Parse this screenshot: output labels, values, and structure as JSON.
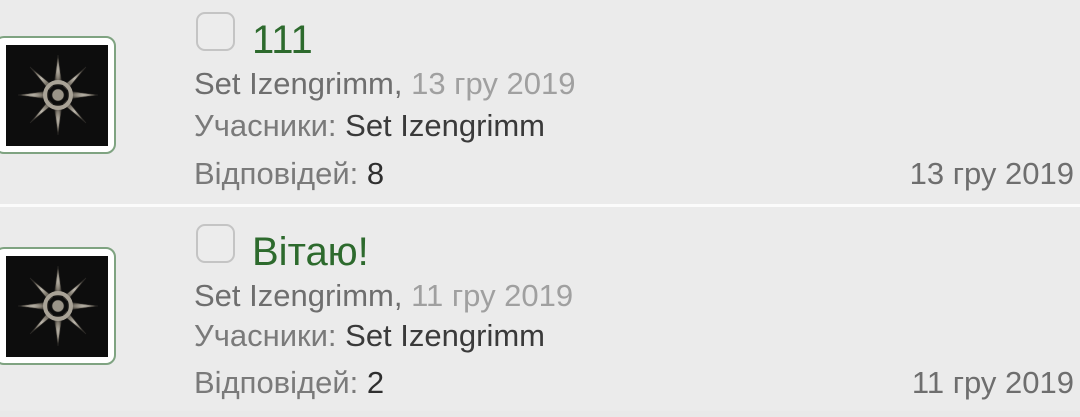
{
  "threads": [
    {
      "title": "111",
      "author": "Set Izengrimm",
      "start_date": "13 гру 2019",
      "participants_label": "Учасники:",
      "participants": "Set Izengrimm",
      "replies_label": "Відповідей:",
      "replies": "8",
      "last_post_date": "13 гру 2019",
      "avatar_icon": "chaos-star-icon"
    },
    {
      "title": "Вітаю!",
      "author": "Set Izengrimm",
      "start_date": "11 гру 2019",
      "participants_label": "Учасники:",
      "participants": "Set Izengrimm",
      "replies_label": "Відповідей:",
      "replies": "2",
      "last_post_date": "11 гру 2019",
      "avatar_icon": "chaos-star-icon"
    }
  ],
  "colors": {
    "title": "#2d6a2d",
    "avatar_border": "#7fa381",
    "background": "#ebebeb"
  }
}
